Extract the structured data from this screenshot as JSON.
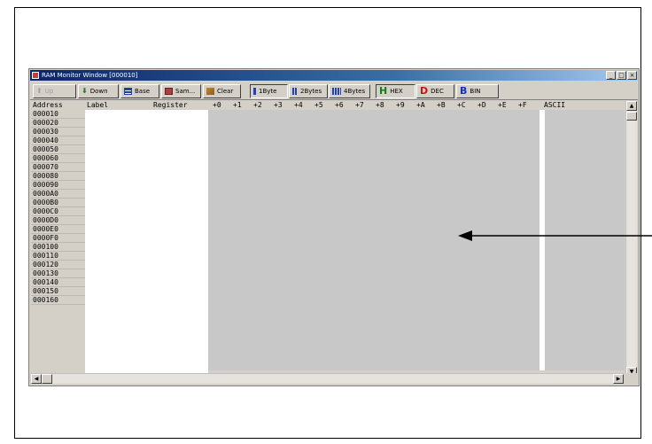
{
  "window": {
    "title": "RAM Monitor Window [000010]",
    "controls": [
      "_",
      "□",
      "×"
    ]
  },
  "toolbar": {
    "buttons": [
      {
        "label": "Up",
        "icon": "up-arrow-icon"
      },
      {
        "label": "Down",
        "icon": "down-arrow-icon"
      },
      {
        "label": "Base",
        "icon": "base-icon"
      },
      {
        "label": "Sam...",
        "icon": "sample-icon"
      },
      {
        "label": "Clear",
        "icon": "clear-icon"
      },
      {
        "label": "1Byte",
        "icon": "one-byte-icon"
      },
      {
        "label": "2Bytes",
        "icon": "two-bytes-icon"
      },
      {
        "label": "4Bytes",
        "icon": "four-bytes-icon"
      },
      {
        "label": "HEX",
        "icon": "hex-icon",
        "glyph": "H"
      },
      {
        "label": "DEC",
        "icon": "dec-icon",
        "glyph": "D"
      },
      {
        "label": "BIN",
        "icon": "bin-icon",
        "glyph": "B"
      }
    ]
  },
  "grid": {
    "headers": {
      "address": "Address",
      "label": "Label",
      "register": "Register",
      "offsets": [
        "+0",
        "+1",
        "+2",
        "+3",
        "+4",
        "+5",
        "+6",
        "+7",
        "+8",
        "+9",
        "+A",
        "+B",
        "+C",
        "+D",
        "+E",
        "+F"
      ],
      "ascii": "ASCII"
    },
    "addresses": [
      "000010",
      "000020",
      "000030",
      "000040",
      "000050",
      "000060",
      "000070",
      "000080",
      "000090",
      "0000A0",
      "0000B0",
      "0000C0",
      "0000D0",
      "0000E0",
      "0000F0",
      "000100",
      "000110",
      "000120",
      "000130",
      "000140",
      "000150",
      "000160"
    ]
  },
  "scrollbars": {
    "up": "▲",
    "down": "▼",
    "left": "◀",
    "right": "▶"
  },
  "colors": {
    "titlebar": "#0a246a",
    "window_face": "#d4d0c8",
    "data_area": "#c8c8c8"
  }
}
